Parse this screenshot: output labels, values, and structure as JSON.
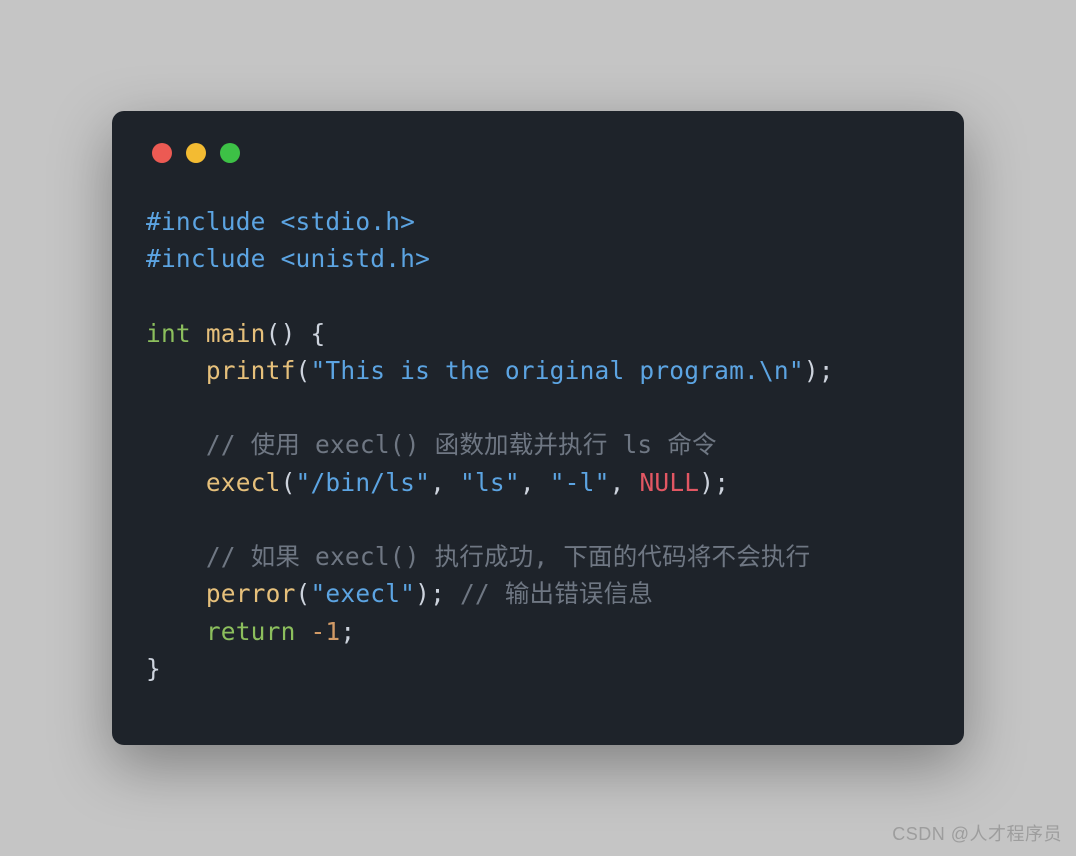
{
  "window": {
    "traffic_lights": {
      "red": "#ec5a53",
      "yellow": "#f3bb32",
      "green": "#3dc146"
    }
  },
  "code": {
    "include1_directive": "#include",
    "include1_header": "<stdio.h>",
    "include2_directive": "#include",
    "include2_header": "<unistd.h>",
    "kw_int": "int",
    "fn_main": "main",
    "main_open": "() {",
    "fn_printf": "printf",
    "printf_open": "(",
    "printf_str": "\"This is the original program.\\n\"",
    "printf_close": ");",
    "comment_execl_load": "// 使用 execl() 函数加载并执行 ls 命令",
    "fn_execl": "execl",
    "execl_open": "(",
    "execl_arg1": "\"/bin/ls\"",
    "execl_comma1": ", ",
    "execl_arg2": "\"ls\"",
    "execl_comma2": ", ",
    "execl_arg3": "\"-l\"",
    "execl_comma3": ", ",
    "execl_null": "NULL",
    "execl_close": ");",
    "comment_after_execl": "// 如果 execl() 执行成功, 下面的代码将不会执行",
    "fn_perror": "perror",
    "perror_open": "(",
    "perror_str": "\"execl\"",
    "perror_close": "); ",
    "comment_perror": "// 输出错误信息",
    "kw_return": "return",
    "return_sp": " ",
    "return_val": "-1",
    "return_semi": ";",
    "main_close": "}"
  },
  "watermark": "CSDN @人才程序员"
}
